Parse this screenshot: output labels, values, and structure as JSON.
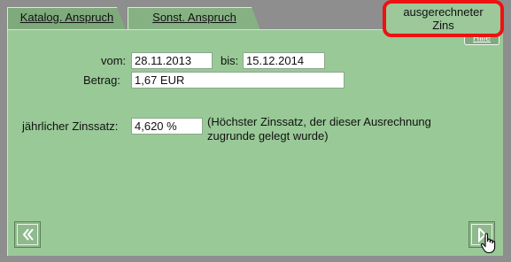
{
  "tabs": [
    {
      "label": "Katalog. Anspruch"
    },
    {
      "label": "Sonst. Anspruch"
    }
  ],
  "active_tab": {
    "label_line1": "ausgerechneter",
    "label_line2": "Zins"
  },
  "help": {
    "label": "Hilfe"
  },
  "form": {
    "from_label": "vom:",
    "from_value": "28.11.2013",
    "to_label": "bis:",
    "to_value": "15.12.2014",
    "amount_label": "Betrag:",
    "amount_value": "1,67 EUR",
    "rate_label": "jährlicher Zinssatz:",
    "rate_value": "4,620 %",
    "rate_note": "(Höchster Zinssatz, der dieser Ausrechnung zugrunde gelegt wurde)"
  },
  "nav": {
    "back_icon": "double-chevron-left-icon",
    "next_icon": "play-right-icon"
  }
}
